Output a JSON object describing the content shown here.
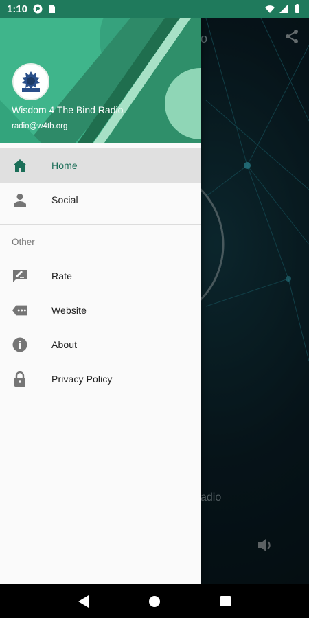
{
  "status_bar": {
    "time": "1:10",
    "left_icons": [
      "notification-icon",
      "sim-card-icon"
    ],
    "right_icons": [
      "wifi-icon",
      "cellular-signal-icon",
      "battery-icon"
    ]
  },
  "background": {
    "title_fragment": "o",
    "subtitle_fragment": "adio",
    "share_icon": "share-icon",
    "volume_icon": "volume-icon"
  },
  "drawer": {
    "header": {
      "app_name": "Wisdom 4 The Bind Radio",
      "email": "radio@w4tb.org",
      "colors": {
        "primary": "#3fb58b",
        "dark": "#1f6e4e",
        "light": "#8fd6b6"
      }
    },
    "items": [
      {
        "label": "Home",
        "icon": "home-icon",
        "active": true
      },
      {
        "label": "Social",
        "icon": "person-icon",
        "active": false
      }
    ],
    "section_other": {
      "title": "Other",
      "items": [
        {
          "label": "Rate",
          "icon": "rate-icon"
        },
        {
          "label": "Website",
          "icon": "website-icon"
        },
        {
          "label": "About",
          "icon": "info-icon"
        },
        {
          "label": "Privacy Policy",
          "icon": "lock-icon"
        }
      ]
    },
    "active_color": "#1b6e58"
  },
  "nav_bar": {
    "buttons": [
      "back-icon",
      "home-circle-icon",
      "recents-icon"
    ]
  }
}
